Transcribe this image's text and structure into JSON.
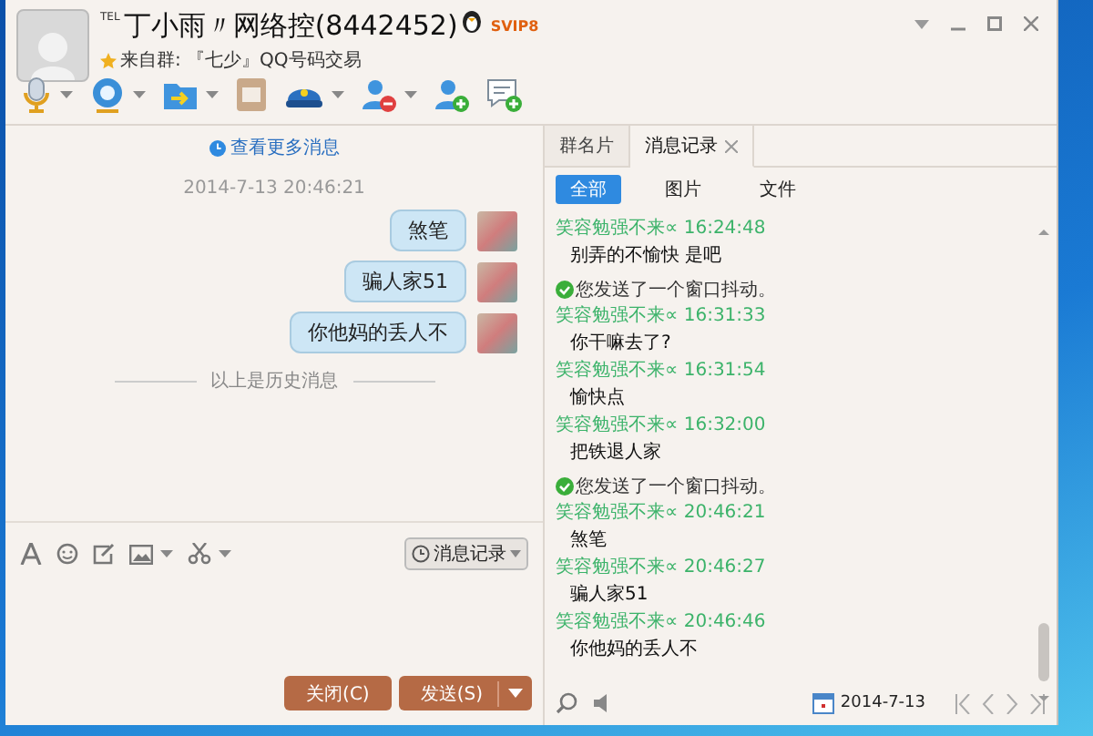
{
  "header": {
    "tel_badge": "TEL",
    "name": "丁小雨〃网络控(8442452)",
    "vip_badge": "SVIP8",
    "group_line": "来自群: 『七少』QQ号码交易"
  },
  "toolbar": [
    {
      "kind": "mic",
      "dropdown": true
    },
    {
      "kind": "camera",
      "dropdown": true
    },
    {
      "kind": "folder",
      "dropdown": true
    },
    {
      "kind": "mail",
      "dropdown": false
    },
    {
      "kind": "police",
      "dropdown": true
    },
    {
      "kind": "remove_user",
      "dropdown": true
    },
    {
      "kind": "add_user",
      "dropdown": false
    },
    {
      "kind": "add_chat",
      "dropdown": false
    }
  ],
  "chat": {
    "more_link": "查看更多消息",
    "timestamp": "2014-7-13 20:46:21",
    "messages": [
      {
        "text": "煞笔"
      },
      {
        "text": "骗人家51"
      },
      {
        "text": "你他妈的丢人不"
      }
    ],
    "history_divider": "以上是历史消息"
  },
  "input_toolbar": {
    "history_button": "消息记录"
  },
  "buttons": {
    "close": "关闭(C)",
    "send": "发送(S)"
  },
  "side_tabs": [
    {
      "label": "群名片",
      "selected": false,
      "closable": false
    },
    {
      "label": "消息记录",
      "selected": true,
      "closable": true
    }
  ],
  "filters": [
    {
      "label": "全部",
      "selected": true
    },
    {
      "label": "图片",
      "selected": false
    },
    {
      "label": "文件",
      "selected": false
    }
  ],
  "history": [
    {
      "kind": "message",
      "sender": "笑容勉强不来∝",
      "time": "16:24:48",
      "text": "别弄的不愉快  是吧"
    },
    {
      "kind": "system",
      "text": "您发送了一个窗口抖动。"
    },
    {
      "kind": "message",
      "sender": "笑容勉强不来∝",
      "time": "16:31:33",
      "text": "你干嘛去了?"
    },
    {
      "kind": "message",
      "sender": "笑容勉强不来∝",
      "time": "16:31:54",
      "text": "愉快点"
    },
    {
      "kind": "message",
      "sender": "笑容勉强不来∝",
      "time": "16:32:00",
      "text": "把铁退人家"
    },
    {
      "kind": "system",
      "text": "您发送了一个窗口抖动。"
    },
    {
      "kind": "message",
      "sender": "笑容勉强不来∝",
      "time": "20:46:21",
      "text": "煞笔"
    },
    {
      "kind": "message",
      "sender": "笑容勉强不来∝",
      "time": "20:46:27",
      "text": "骗人家51"
    },
    {
      "kind": "message",
      "sender": "笑容勉强不来∝",
      "time": "20:46:46",
      "text": "你他妈的丢人不"
    }
  ],
  "date": "2014-7-13"
}
